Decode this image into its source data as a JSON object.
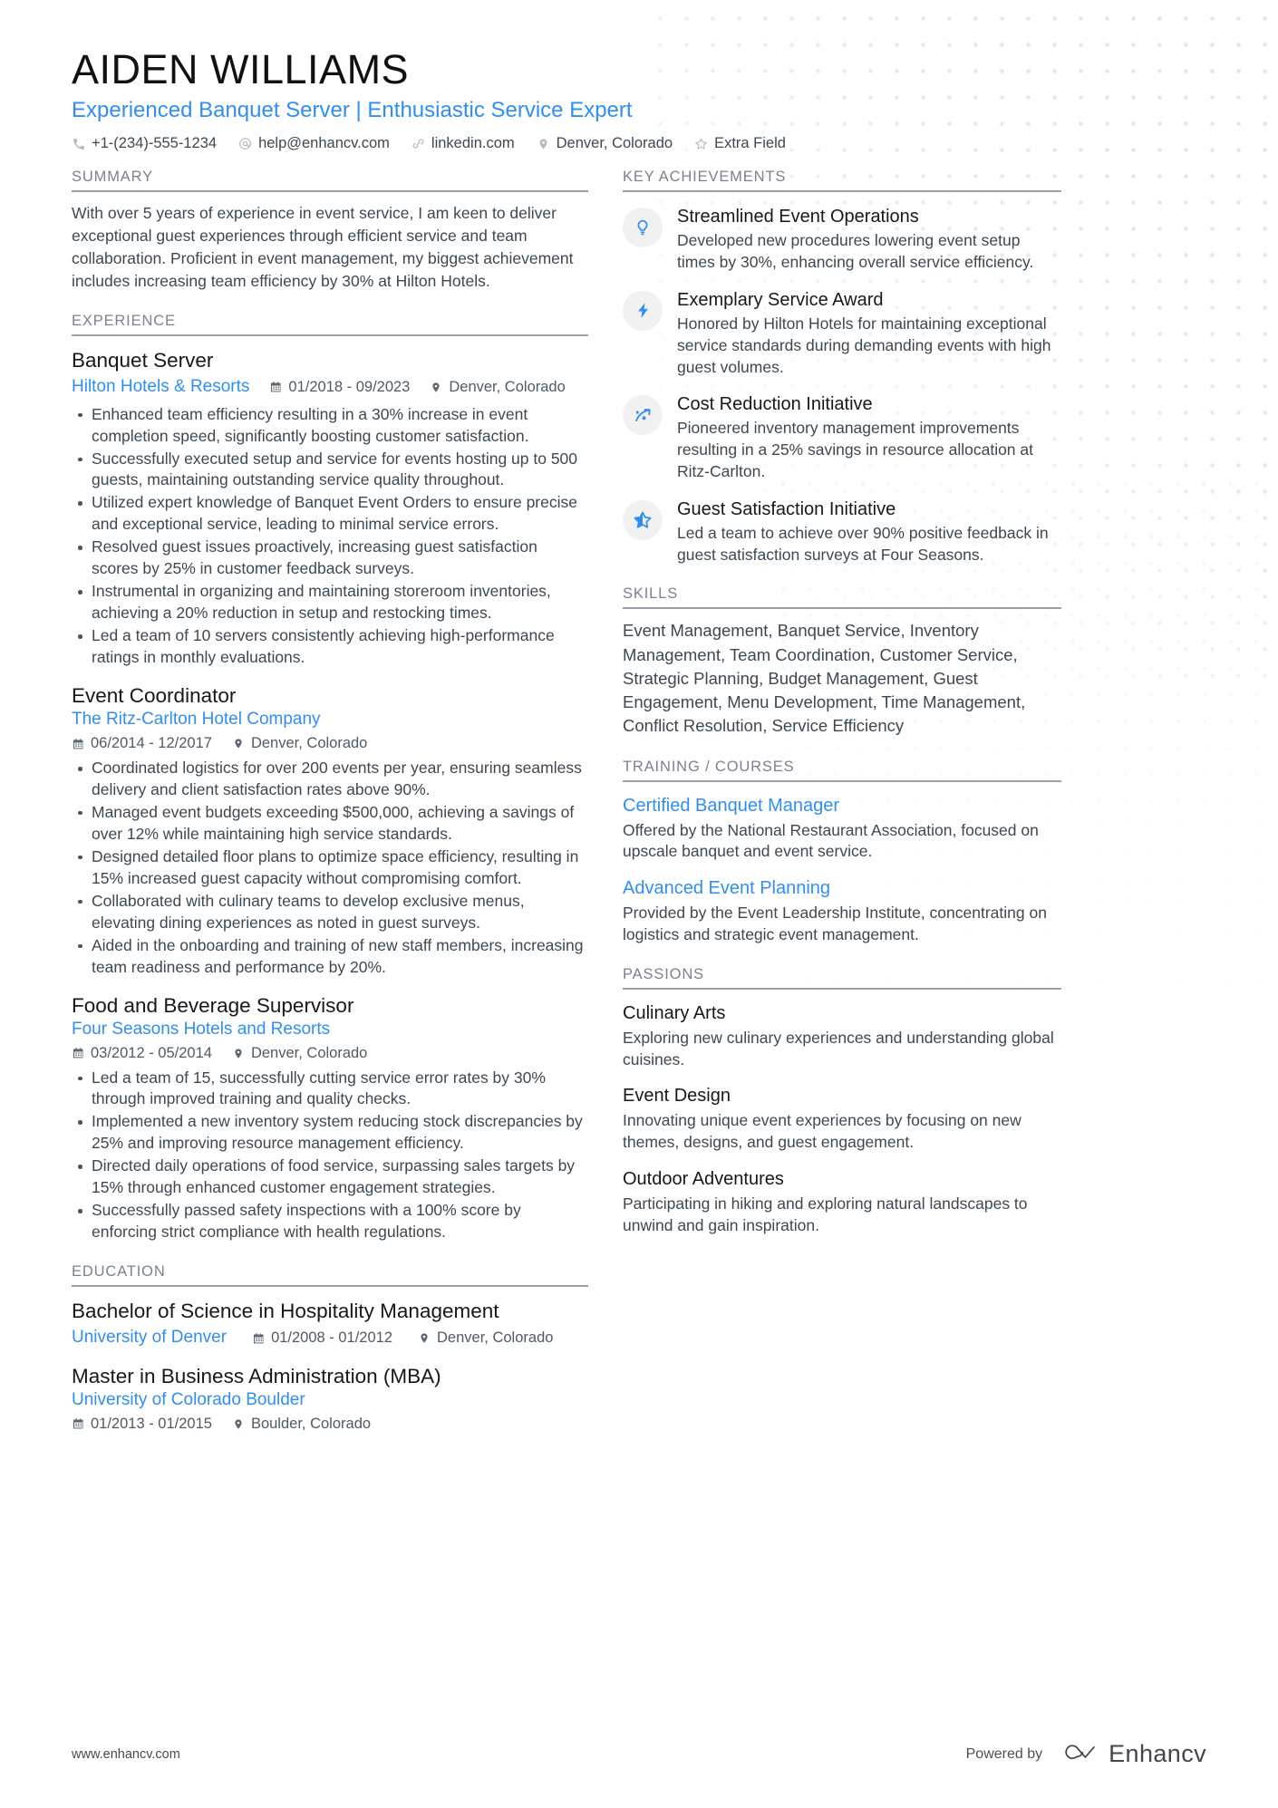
{
  "header": {
    "name": "AIDEN WILLIAMS",
    "tagline": "Experienced Banquet Server | Enthusiastic Service Expert",
    "accent_color": "#2f8ef4",
    "contacts": [
      {
        "icon": "phone-icon",
        "text": "+1-(234)-555-1234"
      },
      {
        "icon": "email-icon",
        "text": "help@enhancv.com"
      },
      {
        "icon": "link-icon",
        "text": "linkedin.com"
      },
      {
        "icon": "location-pin-icon",
        "text": "Denver, Colorado"
      },
      {
        "icon": "star-outline-icon",
        "text": "Extra Field"
      }
    ]
  },
  "left": {
    "summary": {
      "heading": "SUMMARY",
      "text": "With over 5 years of experience in event service, I am keen to deliver exceptional guest experiences through efficient service and team collaboration. Proficient in event management, my biggest achievement includes increasing team efficiency by 30% at Hilton Hotels."
    },
    "experience": {
      "heading": "EXPERIENCE",
      "entries": [
        {
          "title": "Banquet Server",
          "org": "Hilton Hotels & Resorts",
          "dates": "01/2018 - 09/2023",
          "location": "Denver, Colorado",
          "bullets": [
            "Enhanced team efficiency resulting in a 30% increase in event completion speed, significantly boosting customer satisfaction.",
            "Successfully executed setup and service for events hosting up to 500 guests, maintaining outstanding service quality throughout.",
            "Utilized expert knowledge of Banquet Event Orders to ensure precise and exceptional service, leading to minimal service errors.",
            "Resolved guest issues proactively, increasing guest satisfaction scores by 25% in customer feedback surveys.",
            "Instrumental in organizing and maintaining storeroom inventories, achieving a 20% reduction in setup and restocking times.",
            "Led a team of 10 servers consistently achieving high-performance ratings in monthly evaluations."
          ]
        },
        {
          "title": "Event Coordinator",
          "org": "The Ritz-Carlton Hotel Company",
          "dates": "06/2014 - 12/2017",
          "location": "Denver, Colorado",
          "bullets": [
            "Coordinated logistics for over 200 events per year, ensuring seamless delivery and client satisfaction rates above 90%.",
            "Managed event budgets exceeding $500,000, achieving a savings of over 12% while maintaining high service standards.",
            "Designed detailed floor plans to optimize space efficiency, resulting in 15% increased guest capacity without compromising comfort.",
            "Collaborated with culinary teams to develop exclusive menus, elevating dining experiences as noted in guest surveys.",
            "Aided in the onboarding and training of new staff members, increasing team readiness and performance by 20%."
          ]
        },
        {
          "title": "Food and Beverage Supervisor",
          "org": "Four Seasons Hotels and Resorts",
          "dates": "03/2012 - 05/2014",
          "location": "Denver, Colorado",
          "bullets": [
            "Led a team of 15, successfully cutting service error rates by 30% through improved training and quality checks.",
            "Implemented a new inventory system reducing stock discrepancies by 25% and improving resource management efficiency.",
            "Directed daily operations of food service, surpassing sales targets by 15% through enhanced customer engagement strategies.",
            "Successfully passed safety inspections with a 100% score by enforcing strict compliance with health regulations."
          ]
        }
      ]
    },
    "education": {
      "heading": "EDUCATION",
      "entries": [
        {
          "title": "Bachelor of Science in Hospitality Management",
          "org": "University of Denver",
          "dates": "01/2008 - 01/2012",
          "location": "Denver, Colorado"
        },
        {
          "title": "Master in Business Administration (MBA)",
          "org": "University of Colorado Boulder",
          "dates": "01/2013 - 01/2015",
          "location": "Boulder, Colorado"
        }
      ]
    }
  },
  "right": {
    "achievements": {
      "heading": "KEY ACHIEVEMENTS",
      "items": [
        {
          "icon": "lightbulb-icon",
          "title": "Streamlined Event Operations",
          "desc": "Developed new procedures lowering event setup times by 30%, enhancing overall service efficiency."
        },
        {
          "icon": "lightning-bolt-icon",
          "title": "Exemplary Service Award",
          "desc": "Honored by Hilton Hotels for maintaining exceptional service standards during demanding events with high guest volumes."
        },
        {
          "icon": "trending-arrow-icon",
          "title": "Cost Reduction Initiative",
          "desc": "Pioneered inventory management improvements resulting in a 25% savings in resource allocation at Ritz-Carlton."
        },
        {
          "icon": "half-star-icon",
          "title": "Guest Satisfaction Initiative",
          "desc": "Led a team to achieve over 90% positive feedback in guest satisfaction surveys at Four Seasons."
        }
      ]
    },
    "skills": {
      "heading": "SKILLS",
      "text": "Event Management, Banquet Service, Inventory Management, Team Coordination, Customer Service, Strategic Planning, Budget Management, Guest Engagement, Menu Development, Time Management, Conflict Resolution, Service Efficiency"
    },
    "training": {
      "heading": "TRAINING / COURSES",
      "items": [
        {
          "title": "Certified Banquet Manager",
          "desc": "Offered by the National Restaurant Association, focused on upscale banquet and event service."
        },
        {
          "title": "Advanced Event Planning",
          "desc": "Provided by the Event Leadership Institute, concentrating on logistics and strategic event management."
        }
      ]
    },
    "passions": {
      "heading": "PASSIONS",
      "items": [
        {
          "title": "Culinary Arts",
          "desc": "Exploring new culinary experiences and understanding global cuisines."
        },
        {
          "title": "Event Design",
          "desc": "Innovating unique event experiences by focusing on new themes, designs, and guest engagement."
        },
        {
          "title": "Outdoor Adventures",
          "desc": "Participating in hiking and exploring natural landscapes to unwind and gain inspiration."
        }
      ]
    }
  },
  "footer": {
    "url": "www.enhancv.com",
    "powered_by": "Powered by",
    "brand": "Enhancv"
  }
}
